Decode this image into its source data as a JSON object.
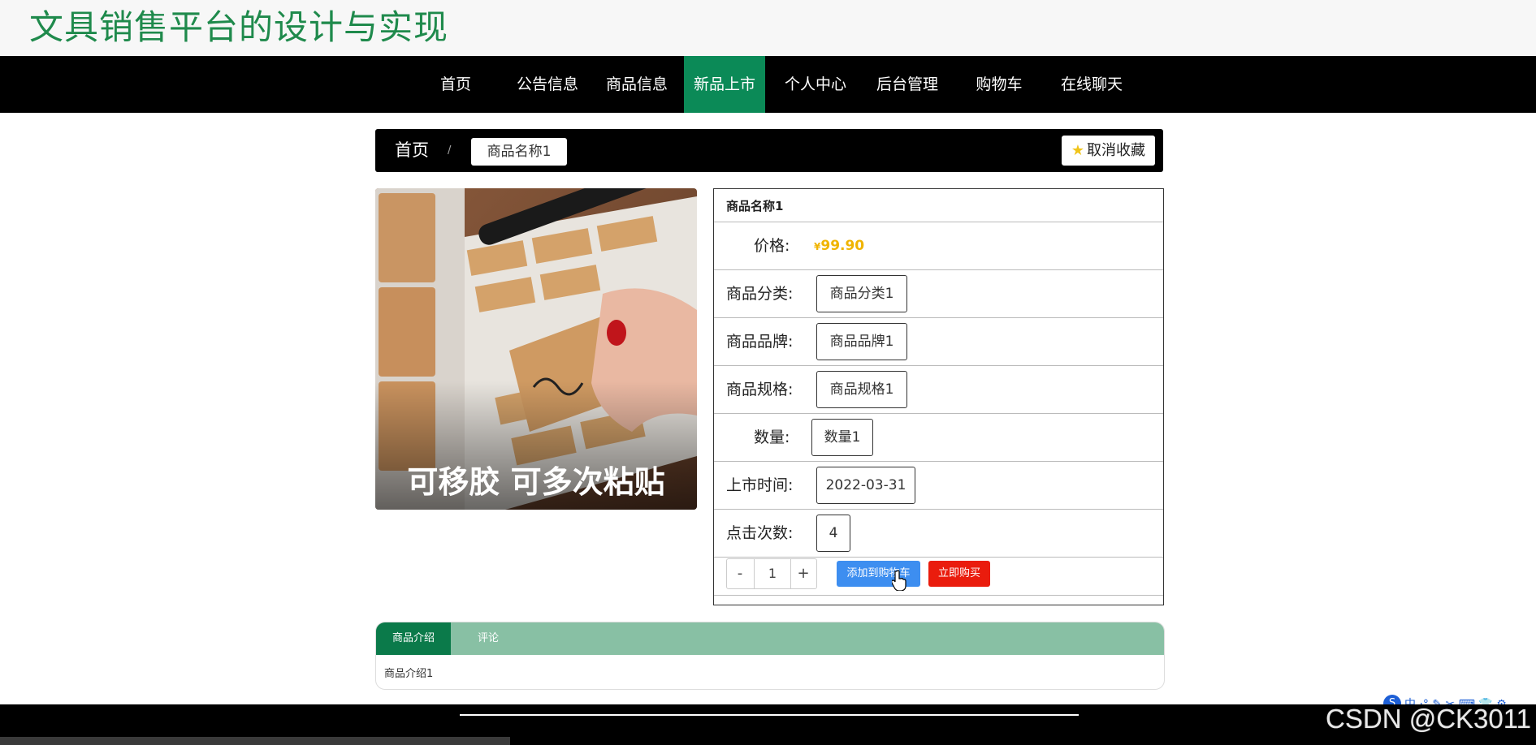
{
  "site": {
    "title": "文具销售平台的设计与实现"
  },
  "nav": {
    "items": [
      {
        "label": "首页"
      },
      {
        "label": "公告信息"
      },
      {
        "label": "商品信息"
      },
      {
        "label": "新品上市",
        "active": true
      },
      {
        "label": "个人中心"
      },
      {
        "label": "后台管理"
      },
      {
        "label": "购物车"
      },
      {
        "label": "在线聊天"
      }
    ]
  },
  "breadcrumb": {
    "home": "首页",
    "separator": "/",
    "current": "商品名称1",
    "favorite_label": "取消收藏"
  },
  "product": {
    "name": "商品名称1",
    "image_caption": "可移胶 可多次粘贴",
    "price_label": "价格:",
    "price_currency": "¥",
    "price_value": "99.90",
    "fields": [
      {
        "label": "商品分类:",
        "value": "商品分类1"
      },
      {
        "label": "商品品牌:",
        "value": "商品品牌1"
      },
      {
        "label": "商品规格:",
        "value": "商品规格1"
      },
      {
        "label": "数量:",
        "value": "数量1"
      },
      {
        "label": "上市时间:",
        "value": "2022-03-31"
      },
      {
        "label": "点击次数:",
        "value": "4"
      }
    ],
    "quantity": {
      "minus": "-",
      "value": "1",
      "plus": "+"
    },
    "add_to_cart_label": "添加到购物车",
    "buy_now_label": "立即购买"
  },
  "tabs": {
    "items": [
      {
        "label": "商品介绍",
        "active": true
      },
      {
        "label": "评论"
      }
    ],
    "content": "商品介绍1"
  },
  "ime": {
    "logo": "S",
    "chars": "中 ·° ✎ ✂ ⌨ 👕 ⚙"
  },
  "watermark": "CSDN @CK3011",
  "colors": {
    "title_green": "#1f8a4c",
    "nav_active": "#0b8a57",
    "price": "#f0b400",
    "add_cart": "#3d8ef0",
    "buy_now": "#ea1c0d",
    "tab_head": "#88c0a4",
    "tab_active": "#0b7a4a"
  }
}
